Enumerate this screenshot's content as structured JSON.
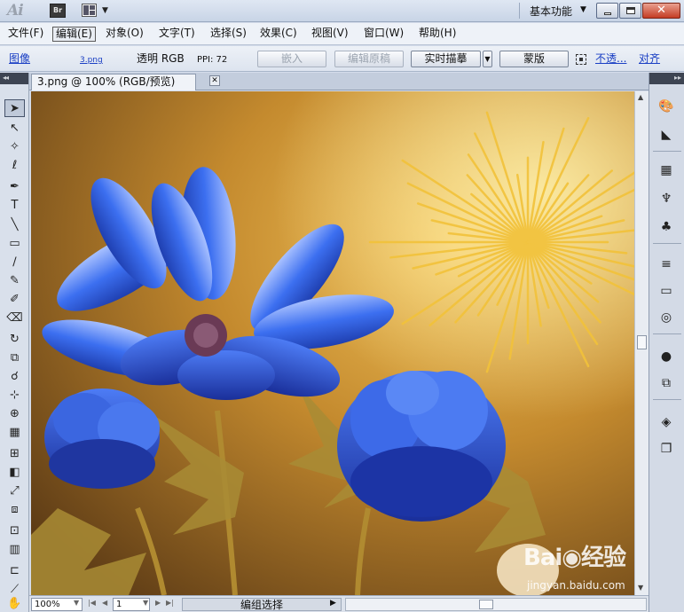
{
  "app": {
    "logo": "Ai",
    "bridge_label": "Br",
    "workspace": "基本功能"
  },
  "menu": [
    {
      "label": "文件(F)",
      "active": false
    },
    {
      "label": "编辑(E)",
      "active": true
    },
    {
      "label": "对象(O)",
      "active": false
    },
    {
      "label": "文字(T)",
      "active": false
    },
    {
      "label": "选择(S)",
      "active": false
    },
    {
      "label": "效果(C)",
      "active": false
    },
    {
      "label": "视图(V)",
      "active": false
    },
    {
      "label": "窗口(W)",
      "active": false
    },
    {
      "label": "帮助(H)",
      "active": false
    }
  ],
  "control": {
    "image_label": "图像",
    "filename": "3.png",
    "mode": "透明 RGB",
    "ppi": "PPI: 72",
    "embed": "嵌入",
    "edit_original": "编辑原稿",
    "live_trace": "实时描摹",
    "mask": "蒙版",
    "opacity": "不透...",
    "align": "对齐"
  },
  "document": {
    "tab_title": "3.png @ 100% (RGB/预览)"
  },
  "status": {
    "zoom": "100%",
    "artboard": "1",
    "info": "编组选择"
  },
  "watermark": {
    "logo": "Bai◉经验",
    "url": "jingyan.baidu.com"
  },
  "colors": {
    "accent": "#1a3fc4",
    "panel_dark": "#3d4452",
    "petal_blue": "#2a5fe0"
  }
}
